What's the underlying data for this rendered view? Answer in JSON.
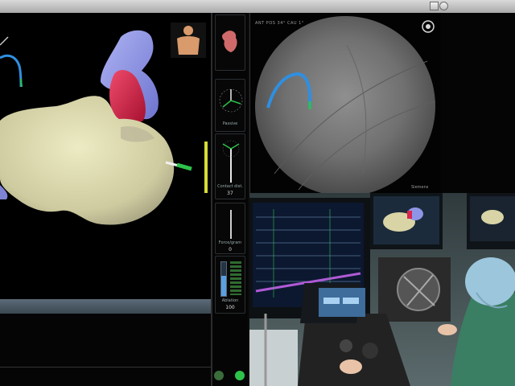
{
  "window": {
    "title": ""
  },
  "gauges": [
    {
      "label": "",
      "value": ""
    },
    {
      "label": "Passive",
      "value": ""
    },
    {
      "label": "Contact dist.",
      "value": "37"
    },
    {
      "label": "Force/gram",
      "value": "0"
    },
    {
      "label": "Ablation",
      "value": "100"
    }
  ],
  "fluoro": {
    "header": "ANT POS 34°   CAU 1°",
    "footer": "Siemens"
  },
  "colors": {
    "anatomy": "#d8d4a6",
    "vessel_blue": "#8f95e6",
    "vessel_red": "#d8264d",
    "catheter_blue": "#2f8fe0",
    "catheter_green": "#2ec24a",
    "panel_band": "#4b5964"
  },
  "icons": [
    "torso-icon",
    "heart-icon",
    "compass-icon",
    "settings-icon",
    "refresh-icon"
  ]
}
